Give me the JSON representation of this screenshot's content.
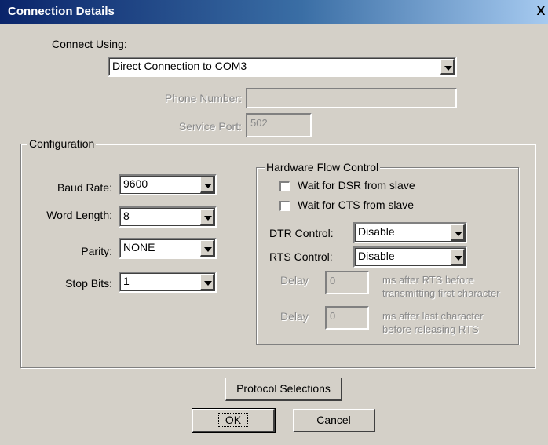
{
  "window": {
    "title": "Connection Details",
    "close_glyph": "X"
  },
  "connect_using": {
    "label": "Connect Using:",
    "value": "Direct Connection to COM3"
  },
  "phone_number": {
    "label": "Phone Number:",
    "value": ""
  },
  "service_port": {
    "label": "Service Port:",
    "value": "502"
  },
  "configuration": {
    "legend": "Configuration",
    "baud_rate": {
      "label": "Baud Rate:",
      "value": "9600"
    },
    "word_length": {
      "label": "Word Length:",
      "value": "8"
    },
    "parity": {
      "label": "Parity:",
      "value": "NONE"
    },
    "stop_bits": {
      "label": "Stop Bits:",
      "value": "1"
    }
  },
  "hardware_flow": {
    "legend": "Hardware Flow Control",
    "wait_dsr": {
      "label": "Wait for DSR from slave",
      "checked": false
    },
    "wait_cts": {
      "label": "Wait for CTS from slave",
      "checked": false
    },
    "dtr": {
      "label": "DTR Control:",
      "value": "Disable"
    },
    "rts": {
      "label": "RTS Control:",
      "value": "Disable"
    },
    "delay1": {
      "label": "Delay",
      "value": "0",
      "desc1": "ms after RTS before",
      "desc2": "transmitting first character"
    },
    "delay2": {
      "label": "Delay",
      "value": "0",
      "desc1": "ms after last character",
      "desc2": "before releasing RTS"
    }
  },
  "buttons": {
    "protocol": "Protocol Selections",
    "ok": "OK",
    "cancel": "Cancel"
  },
  "colors": {
    "title_start": "#0a246a",
    "title_end": "#a6caf0",
    "face": "#d4d0c8"
  }
}
